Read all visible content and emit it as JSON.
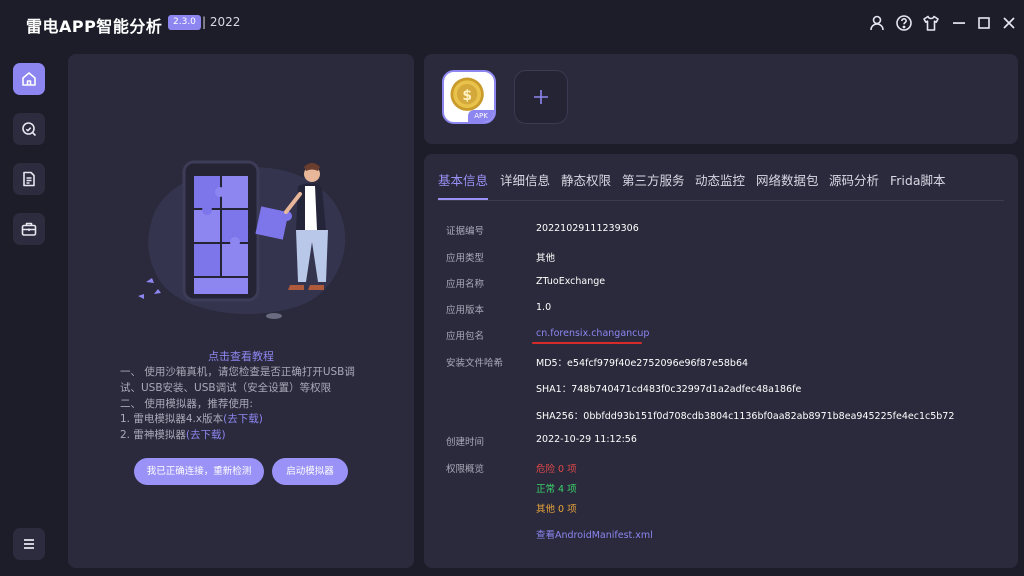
{
  "app": {
    "title": "雷电APP智能分析",
    "version": "2.3.0",
    "year": "| 2022"
  },
  "colors": {
    "accent": "#8d86f0",
    "danger": "#e04848",
    "normal": "#3bd46a",
    "other": "#e9a33a",
    "background": "#1d1d2a",
    "panel": "#2a2a3c"
  },
  "titlebar_icons": [
    "user-icon",
    "help-icon",
    "shirt-icon",
    "minimize-icon",
    "maximize-icon",
    "close-icon"
  ],
  "rail": {
    "items": [
      "home-icon",
      "scan-icon",
      "document-icon",
      "toolbox-icon"
    ],
    "menu": "menu-icon"
  },
  "tutorial": {
    "title": "点击查看教程",
    "line1": "一、 使用沙箱真机，请您检查是否正确打开USB调",
    "line2": "试、USB安装、USB调试（安全设置）等权限",
    "line3": "二、 使用模拟器，推荐使用:",
    "line4_prefix": "1. 雷电模拟器4.x版本",
    "line4_link": "(去下载)",
    "line5_prefix": "2. 雷神模拟器",
    "line5_link": "(去下载)",
    "btn_recheck": "我已正确连接，重新检测",
    "btn_start_emulator": "启动模拟器"
  },
  "apk": {
    "tag": "APK",
    "add_symbol": "+"
  },
  "tabs": [
    "基本信息",
    "详细信息",
    "静态权限",
    "第三方服务",
    "动态监控",
    "网络数据包",
    "源码分析",
    "Frida脚本"
  ],
  "active_tab": "基本信息",
  "info": {
    "cert_no": {
      "label": "证据编号",
      "value": "20221029111239306"
    },
    "app_type": {
      "label": "应用类型",
      "value": "其他"
    },
    "app_name": {
      "label": "应用名称",
      "value": "ZTuoExchange"
    },
    "app_version": {
      "label": "应用版本",
      "value": "1.0"
    },
    "package_name": {
      "label": "应用包名",
      "value": "cn.forensix.changancup"
    },
    "hash": {
      "label": "安装文件哈希",
      "md5": "MD5：e54fcf979f40e2752096e96f87e58b64",
      "sha1": "SHA1：748b740471cd483f0c32997d1a2adfec48a186fe",
      "sha256": "SHA256：0bbfdd93b151f0d708cdb3804c1136bf0aa82ab8971b8ea945225fe4ec1c5b72"
    },
    "created_time": {
      "label": "创建时间",
      "value": "2022-10-29 11:12:56"
    },
    "permissions": {
      "label": "权限概览",
      "danger": "危险 0 项",
      "normal": "正常 4 项",
      "other": "其他 0 项"
    },
    "manifest_link": "查看AndroidManifest.xml"
  }
}
